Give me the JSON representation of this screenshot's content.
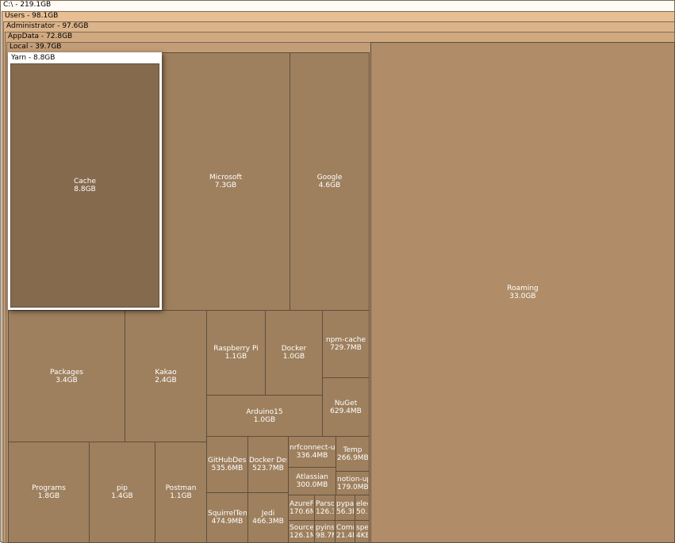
{
  "path": {
    "drive": "C:\\ - 219.1GB",
    "users": "Users - 98.1GB",
    "administrator": "Administrator - 97.6GB",
    "appdata": "AppData - 72.8GB",
    "local": "Local - 39.7GB"
  },
  "colors": {
    "drive": "#fffaf4",
    "users": "#e8bf93",
    "administrator": "#dcb48a",
    "appdata": "#d1a980",
    "local": "#c29d77"
  },
  "focused": {
    "title": "Yarn - 8.8GB",
    "cache_name": "Cache",
    "cache_size": "8.8GB"
  },
  "folders": [
    {
      "id": "microsoft",
      "name": "Microsoft",
      "size": "7.3GB"
    },
    {
      "id": "google",
      "name": "Google",
      "size": "4.6GB"
    },
    {
      "id": "roaming",
      "name": "Roaming",
      "size": "33.0GB"
    },
    {
      "id": "packages",
      "name": "Packages",
      "size": "3.4GB"
    },
    {
      "id": "kakao",
      "name": "Kakao",
      "size": "2.4GB"
    },
    {
      "id": "raspberry",
      "name": "Raspberry Pi",
      "size": "1.1GB"
    },
    {
      "id": "docker",
      "name": "Docker",
      "size": "1.0GB"
    },
    {
      "id": "npmcache",
      "name": "npm-cache",
      "size": "729.7MB"
    },
    {
      "id": "nuget",
      "name": "NuGet",
      "size": "629.4MB"
    },
    {
      "id": "arduino",
      "name": "Arduino15",
      "size": "1.0GB"
    },
    {
      "id": "programs",
      "name": "Programs",
      "size": "1.8GB"
    },
    {
      "id": "pip",
      "name": "pip",
      "size": "1.4GB"
    },
    {
      "id": "postman",
      "name": "Postman",
      "size": "1.1GB"
    },
    {
      "id": "githubdesk",
      "name": "GitHubDesk",
      "size": "535.6MB"
    },
    {
      "id": "dockerdes",
      "name": "Docker Des",
      "size": "523.7MB"
    },
    {
      "id": "nrfconnect",
      "name": "nrfconnect-up",
      "size": "336.4MB"
    },
    {
      "id": "temp",
      "name": "Temp",
      "size": "266.9MB"
    },
    {
      "id": "atlassian",
      "name": "Atlassian",
      "size": "300.0MB"
    },
    {
      "id": "notionup",
      "name": "notion-up",
      "size": "179.0MB"
    },
    {
      "id": "squirreltemp",
      "name": "SquirrelTem",
      "size": "474.9MB"
    },
    {
      "id": "jedi",
      "name": "Jedi",
      "size": "466.3MB"
    },
    {
      "id": "azuref",
      "name": "AzureF",
      "size": "170.6M"
    },
    {
      "id": "parso",
      "name": "Parso",
      "size": "126.3"
    },
    {
      "id": "pypa",
      "name": "pypa",
      "size": "56.3M"
    },
    {
      "id": "elec",
      "name": "elec",
      "size": "50.2"
    },
    {
      "id": "sourcet",
      "name": "SourceT",
      "size": "126.1M"
    },
    {
      "id": "pyins",
      "name": "pyins",
      "size": "98.7M"
    },
    {
      "id": "comr",
      "name": "Comr",
      "size": "21.4M"
    },
    {
      "id": "spe",
      "name": "spe",
      "size": "4KE"
    }
  ]
}
